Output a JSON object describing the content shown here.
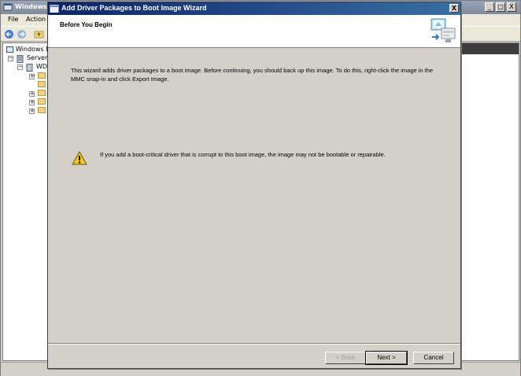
{
  "background_window": {
    "title": "Windows D",
    "menu": [
      "File",
      "Action"
    ],
    "tree": [
      {
        "label": "Windows D"
      },
      {
        "label": "Servers"
      },
      {
        "label": "WD"
      }
    ],
    "controls": {
      "minimize": "_",
      "maximize": "□",
      "close": "X"
    }
  },
  "wizard": {
    "title": "Add Driver Packages to Boot Image Wizard",
    "close_label": "X",
    "page_title": "Before You Begin",
    "intro": "This wizard adds driver packages to a boot image. Before continuing, you should back up this image. To do this, right-click the image in the MMC snap-in and click Export Image.",
    "warning": "If you add a boot-critical driver that is corrupt to this boot image, the image may not be bootable or repairable.",
    "buttons": {
      "back": "< Back",
      "next": "Next >",
      "cancel": "Cancel"
    }
  },
  "colors": {
    "title_bar_start": "#0a246a",
    "title_bar_end": "#3a6ea5",
    "dialog_face": "#d4d0c8",
    "warning_yellow": "#f5c518"
  },
  "icons": {
    "wizard": "wizard-window-icon",
    "banner": "driver-package-computer-icon",
    "warning": "warning-triangle-icon"
  }
}
